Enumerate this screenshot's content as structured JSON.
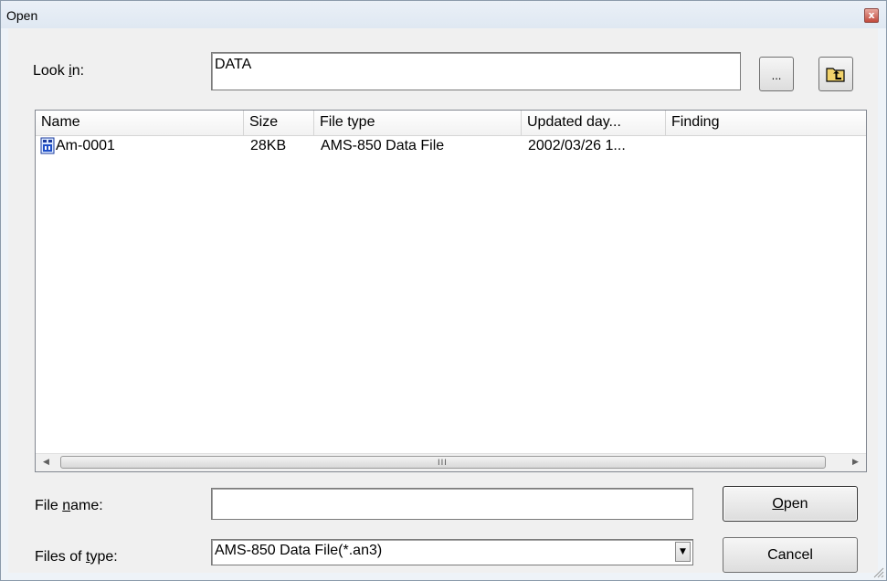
{
  "window": {
    "title": "Open",
    "close_glyph": "x"
  },
  "look_in": {
    "label_pre": "Look ",
    "label_key": "i",
    "label_post": "n:",
    "value": "DATA",
    "browse_label": "...",
    "up_folder_icon": "up-one-level-folder-icon"
  },
  "list": {
    "columns": [
      "Name",
      "Size",
      "File type",
      "Updated day...",
      "Finding"
    ],
    "rows": [
      {
        "name": "Am-0001",
        "size": "28KB",
        "type": "AMS-850 Data File",
        "updated": "2002/03/26 1...",
        "finding": ""
      }
    ],
    "scroll_grip": "III"
  },
  "file_name": {
    "label_pre": "File ",
    "label_key": "n",
    "label_post": "ame:",
    "value": ""
  },
  "file_type": {
    "label_pre": "Files of ",
    "label_key": "t",
    "label_post": "ype:",
    "value": "AMS-850 Data File(*.an3)"
  },
  "buttons": {
    "open_key": "O",
    "open_rest": "pen",
    "cancel": "Cancel"
  }
}
